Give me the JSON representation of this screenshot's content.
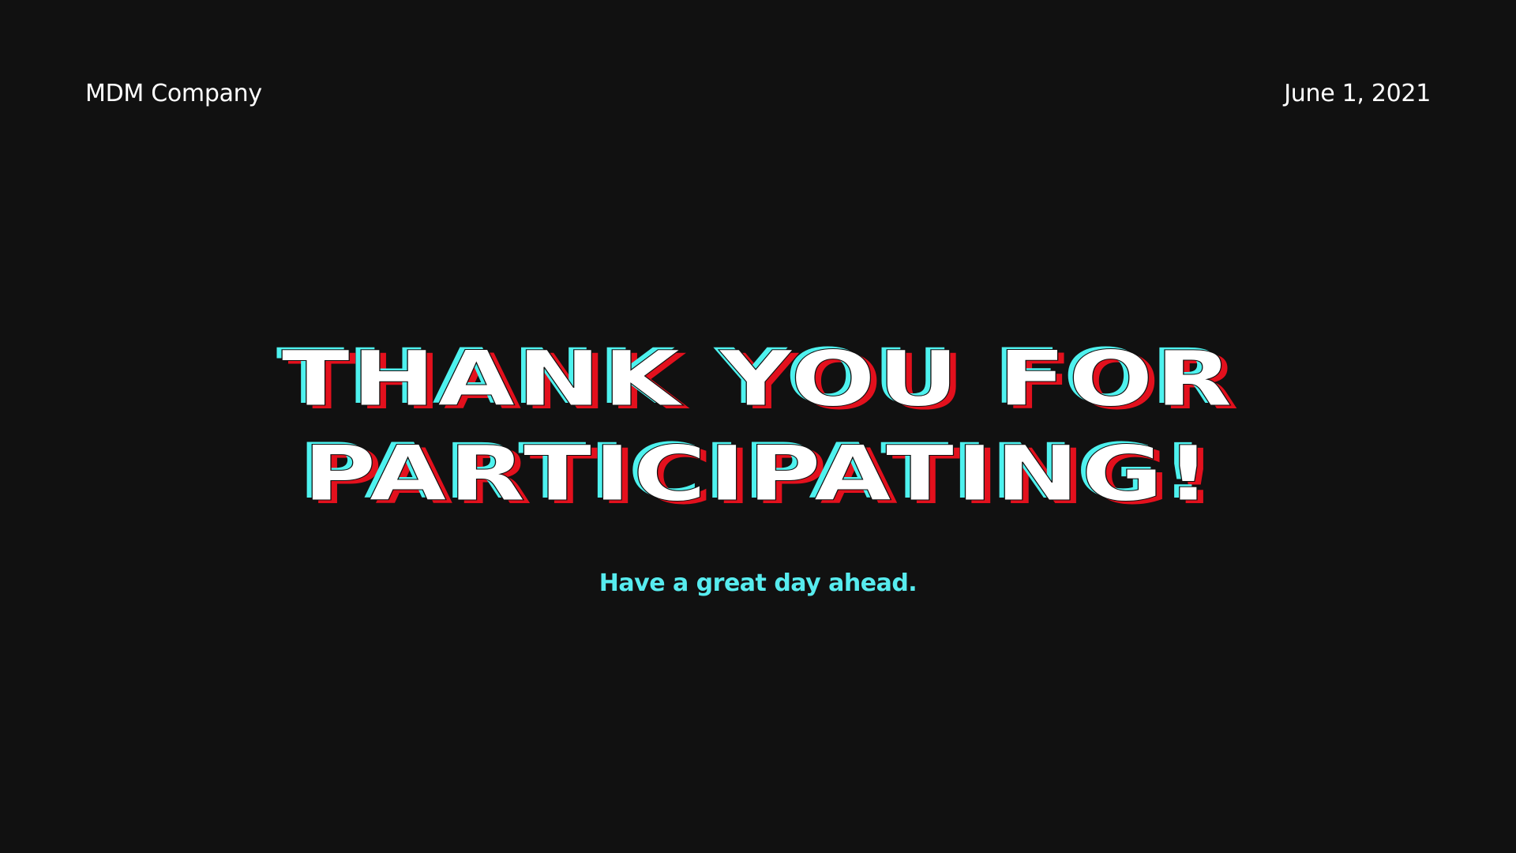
{
  "header": {
    "company": "MDM Company",
    "date": "June 1, 2021"
  },
  "main": {
    "headline_lines": [
      "THANK YOU FOR",
      "PARTICIPATING!"
    ],
    "tagline": "Have a great day ahead."
  },
  "colors": {
    "background": "#111111",
    "headline_fill": "#ffffff",
    "glitch_cyan": "#4ef2ef",
    "glitch_red": "#e3101d",
    "tagline": "#57ecef"
  }
}
